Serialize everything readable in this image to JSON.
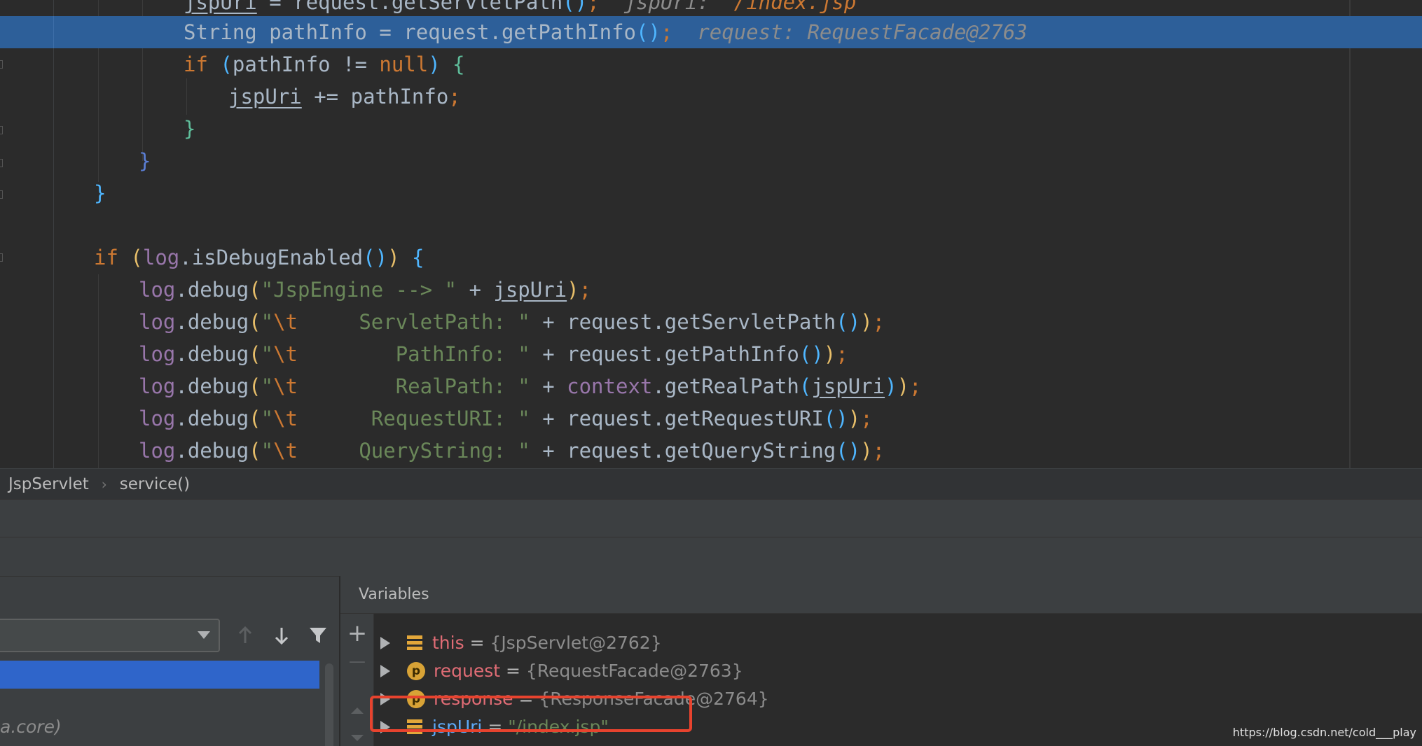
{
  "editor": {
    "lines": [
      {
        "parts": [
          [
            "jspUri",
            "under"
          ],
          [
            " = request.getServletPath",
            ""
          ],
          [
            "(",
            "p2"
          ],
          [
            ")",
            "p2"
          ],
          [
            ";",
            "kw"
          ],
          [
            "  jspUri: ",
            "hint"
          ],
          [
            "\"/index.jsp\"",
            "hint-orange"
          ]
        ]
      },
      {
        "parts": [
          [
            "String pathInfo = request.getPathInfo",
            ""
          ],
          [
            "(",
            "p2"
          ],
          [
            ")",
            "p2"
          ],
          [
            ";",
            "kw"
          ],
          [
            "  request: RequestFacade@2763",
            "hint"
          ]
        ]
      },
      {
        "parts": [
          [
            "if",
            "kw"
          ],
          [
            " ",
            ""
          ],
          [
            "(",
            "p2"
          ],
          [
            "pathInfo != ",
            ""
          ],
          [
            "null",
            "kw"
          ],
          [
            ")",
            "p2"
          ],
          [
            " ",
            ""
          ],
          [
            "{",
            "p3"
          ]
        ]
      },
      {
        "parts": [
          [
            "jspUri",
            "under"
          ],
          [
            " += pathInfo",
            ""
          ],
          [
            ";",
            "kw"
          ]
        ]
      },
      {
        "parts": [
          [
            "}",
            "p3"
          ]
        ]
      },
      {
        "parts": [
          [
            "}",
            "p4"
          ]
        ]
      },
      {
        "parts": [
          [
            "}",
            "p2"
          ]
        ]
      },
      {
        "parts": [
          [
            "",
            ""
          ]
        ]
      },
      {
        "parts": [
          [
            "if",
            "kw"
          ],
          [
            " ",
            ""
          ],
          [
            "(",
            "p1"
          ],
          [
            "log",
            "fld"
          ],
          [
            ".isDebugEnabled",
            ""
          ],
          [
            "(",
            "p2"
          ],
          [
            ")",
            "p2"
          ],
          [
            ")",
            "p1"
          ],
          [
            " ",
            ""
          ],
          [
            "{",
            "p2"
          ]
        ]
      },
      {
        "parts": [
          [
            "log",
            "fld"
          ],
          [
            ".debug",
            ""
          ],
          [
            "(",
            "p1"
          ],
          [
            "\"JspEngine --> \"",
            "str"
          ],
          [
            " + ",
            ""
          ],
          [
            "jspUri",
            "under"
          ],
          [
            ")",
            "p1"
          ],
          [
            ";",
            "kw"
          ]
        ]
      },
      {
        "parts": [
          [
            "log",
            "fld"
          ],
          [
            ".debug",
            ""
          ],
          [
            "(",
            "p1"
          ],
          [
            "\"",
            "str"
          ],
          [
            "\\t",
            "esc"
          ],
          [
            "     ServletPath: \"",
            "str"
          ],
          [
            " + request.getServletPath",
            ""
          ],
          [
            "(",
            "p2"
          ],
          [
            ")",
            "p2"
          ],
          [
            ")",
            "p1"
          ],
          [
            ";",
            "kw"
          ]
        ]
      },
      {
        "parts": [
          [
            "log",
            "fld"
          ],
          [
            ".debug",
            ""
          ],
          [
            "(",
            "p1"
          ],
          [
            "\"",
            "str"
          ],
          [
            "\\t",
            "esc"
          ],
          [
            "        PathInfo: \"",
            "str"
          ],
          [
            " + request.getPathInfo",
            ""
          ],
          [
            "(",
            "p2"
          ],
          [
            ")",
            "p2"
          ],
          [
            ")",
            "p1"
          ],
          [
            ";",
            "kw"
          ]
        ]
      },
      {
        "parts": [
          [
            "log",
            "fld"
          ],
          [
            ".debug",
            ""
          ],
          [
            "(",
            "p1"
          ],
          [
            "\"",
            "str"
          ],
          [
            "\\t",
            "esc"
          ],
          [
            "        RealPath: \"",
            "str"
          ],
          [
            " + ",
            ""
          ],
          [
            "context",
            "fld"
          ],
          [
            ".getRealPath",
            ""
          ],
          [
            "(",
            "p2"
          ],
          [
            "jspUri",
            "under"
          ],
          [
            ")",
            "p2"
          ],
          [
            ")",
            "p1"
          ],
          [
            ";",
            "kw"
          ]
        ]
      },
      {
        "parts": [
          [
            "log",
            "fld"
          ],
          [
            ".debug",
            ""
          ],
          [
            "(",
            "p1"
          ],
          [
            "\"",
            "str"
          ],
          [
            "\\t",
            "esc"
          ],
          [
            "      RequestURI: \"",
            "str"
          ],
          [
            " + request.getRequestURI",
            ""
          ],
          [
            "(",
            "p2"
          ],
          [
            ")",
            "p2"
          ],
          [
            ")",
            "p1"
          ],
          [
            ";",
            "kw"
          ]
        ]
      },
      {
        "parts": [
          [
            "log",
            "fld"
          ],
          [
            ".debug",
            ""
          ],
          [
            "(",
            "p1"
          ],
          [
            "\"",
            "str"
          ],
          [
            "\\t",
            "esc"
          ],
          [
            "     QueryString: \"",
            "str"
          ],
          [
            " + request.getQueryString",
            ""
          ],
          [
            "(",
            "p2"
          ],
          [
            ")",
            "p2"
          ],
          [
            ")",
            "p1"
          ],
          [
            ";",
            "kw"
          ]
        ]
      }
    ]
  },
  "breadcrumb": {
    "class_name": "JspServlet",
    "method": "service()",
    "separator": "›"
  },
  "frames": {
    "partial_frame_text": "a.core)"
  },
  "variables": {
    "title": "Variables",
    "items": [
      {
        "icon": "field-icon",
        "name": "this",
        "eq": " = ",
        "value": "{JspServlet@2762}",
        "name_class": "vname-red",
        "value_class": "vval"
      },
      {
        "icon": "param-icon",
        "name": "request",
        "eq": " = ",
        "value": "{RequestFacade@2763}",
        "name_class": "vname-red",
        "value_class": "vval"
      },
      {
        "icon": "param-icon",
        "name": "response",
        "eq": " = ",
        "value": "{ResponseFacade@2764}",
        "name_class": "vname-red",
        "value_class": "vval"
      },
      {
        "icon": "field-icon",
        "name": "jspUri",
        "eq": " = ",
        "value": "\"/index.jsp\"",
        "name_class": "vname-blue",
        "value_class": "vval-str"
      }
    ]
  },
  "icons": {
    "param_letter": "p",
    "add": "+",
    "remove": "—"
  },
  "watermark": "https://blog.csdn.net/cold___play",
  "colors": {
    "background": "#2b2b2b",
    "highlight": "#2d5f99",
    "keyword": "#cc7832",
    "string": "#6a8759",
    "selection": "#2f65ca",
    "annotation_box": "#e8432e"
  }
}
